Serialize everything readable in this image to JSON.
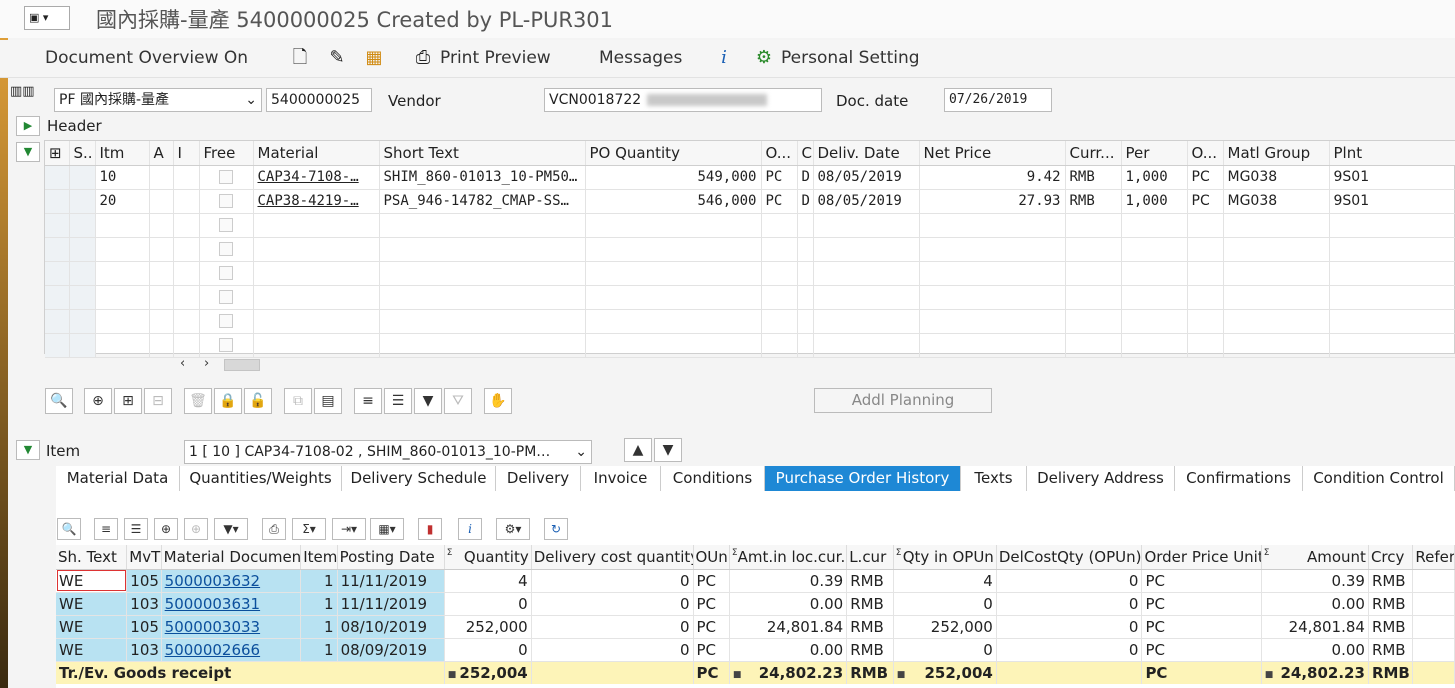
{
  "window": {
    "title": "國內採購-量產 5400000025 Created by PL-PUR301"
  },
  "toolbar": {
    "doc_overview": "Document Overview On",
    "print_preview": "Print Preview",
    "messages": "Messages",
    "personal_setting": "Personal Setting"
  },
  "header": {
    "doc_type": "PF 國內採購-量產",
    "po_number": "5400000025",
    "vendor_label": "Vendor",
    "vendor_value": "VCN0018722",
    "doc_date_label": "Doc. date",
    "doc_date": "07/26/2019",
    "header_label": "Header"
  },
  "items_grid": {
    "columns": [
      "S..",
      "Itm",
      "A",
      "I",
      "Free",
      "Material",
      "Short Text",
      "PO Quantity",
      "O...",
      "C",
      "Deliv. Date",
      "Net Price",
      "Curr...",
      "Per",
      "O...",
      "Matl Group",
      "Plnt"
    ],
    "rows": [
      {
        "itm": "10",
        "material": "CAP34-7108-…",
        "short_text": "SHIM_860-01013_10-PM50…",
        "qty": "549,000",
        "oun": "PC",
        "c": "D",
        "deliv_date": "08/05/2019",
        "net_price": "9.42",
        "curr": "RMB",
        "per": "1,000",
        "opu": "PC",
        "matl_group": "MG038",
        "plnt": "9S01"
      },
      {
        "itm": "20",
        "material": "CAP38-4219-…",
        "short_text": "PSA_946-14782_CMAP-SS…",
        "qty": "546,000",
        "oun": "PC",
        "c": "D",
        "deliv_date": "08/05/2019",
        "net_price": "27.93",
        "curr": "RMB",
        "per": "1,000",
        "opu": "PC",
        "matl_group": "MG038",
        "plnt": "9S01"
      }
    ]
  },
  "addl_planning": "Addl Planning",
  "item_selector": {
    "label": "Item",
    "value": "1 [ 10 ] CAP34-7108-02 , SHIM_860-01013_10-PM…"
  },
  "tabs": [
    "Material Data",
    "Quantities/Weights",
    "Delivery Schedule",
    "Delivery",
    "Invoice",
    "Conditions",
    "Purchase Order History",
    "Texts",
    "Delivery Address",
    "Confirmations",
    "Condition Control"
  ],
  "active_tab": "Purchase Order History",
  "history_grid": {
    "columns": [
      "Sh. Text",
      "MvT",
      "Material Document",
      "Item",
      "Posting Date",
      "Quantity",
      "Delivery cost quantity",
      "OUn",
      "Amt.in loc.cur.",
      "L.cur",
      "Qty in OPUn",
      "DelCostQty (OPUn)",
      "Order Price Unit",
      "Amount",
      "Crcy",
      "Referen"
    ],
    "rows": [
      {
        "sh": "WE",
        "mvt": "105",
        "doc": "5000003632",
        "item": "1",
        "date": "11/11/2019",
        "qty": "4",
        "dcq": "0",
        "oun": "PC",
        "amt": "0.39",
        "lcur": "RMB",
        "qopun": "4",
        "dcqo": "0",
        "opu": "PC",
        "amount": "0.39",
        "crcy": "RMB"
      },
      {
        "sh": "WE",
        "mvt": "103",
        "doc": "5000003631",
        "item": "1",
        "date": "11/11/2019",
        "qty": "0",
        "dcq": "0",
        "oun": "PC",
        "amt": "0.00",
        "lcur": "RMB",
        "qopun": "0",
        "dcqo": "0",
        "opu": "PC",
        "amount": "0.00",
        "crcy": "RMB"
      },
      {
        "sh": "WE",
        "mvt": "105",
        "doc": "5000003033",
        "item": "1",
        "date": "08/10/2019",
        "qty": "252,000",
        "dcq": "0",
        "oun": "PC",
        "amt": "24,801.84",
        "lcur": "RMB",
        "qopun": "252,000",
        "dcqo": "0",
        "opu": "PC",
        "amount": "24,801.84",
        "crcy": "RMB"
      },
      {
        "sh": "WE",
        "mvt": "103",
        "doc": "5000002666",
        "item": "1",
        "date": "08/09/2019",
        "qty": "0",
        "dcq": "0",
        "oun": "PC",
        "amt": "0.00",
        "lcur": "RMB",
        "qopun": "0",
        "dcqo": "0",
        "opu": "PC",
        "amount": "0.00",
        "crcy": "RMB"
      }
    ],
    "total": {
      "label": "Tr./Ev. Goods receipt",
      "qty": "252,004",
      "oun": "PC",
      "amt": "24,802.23",
      "lcur": "RMB",
      "qopun": "252,004",
      "opu": "PC",
      "amount": "24,802.23",
      "crcy": "RMB"
    }
  },
  "colors": {
    "active_tab": "#1e88d5",
    "row_highlight": "#b8e2f2",
    "total_row": "#fdf4b8"
  }
}
